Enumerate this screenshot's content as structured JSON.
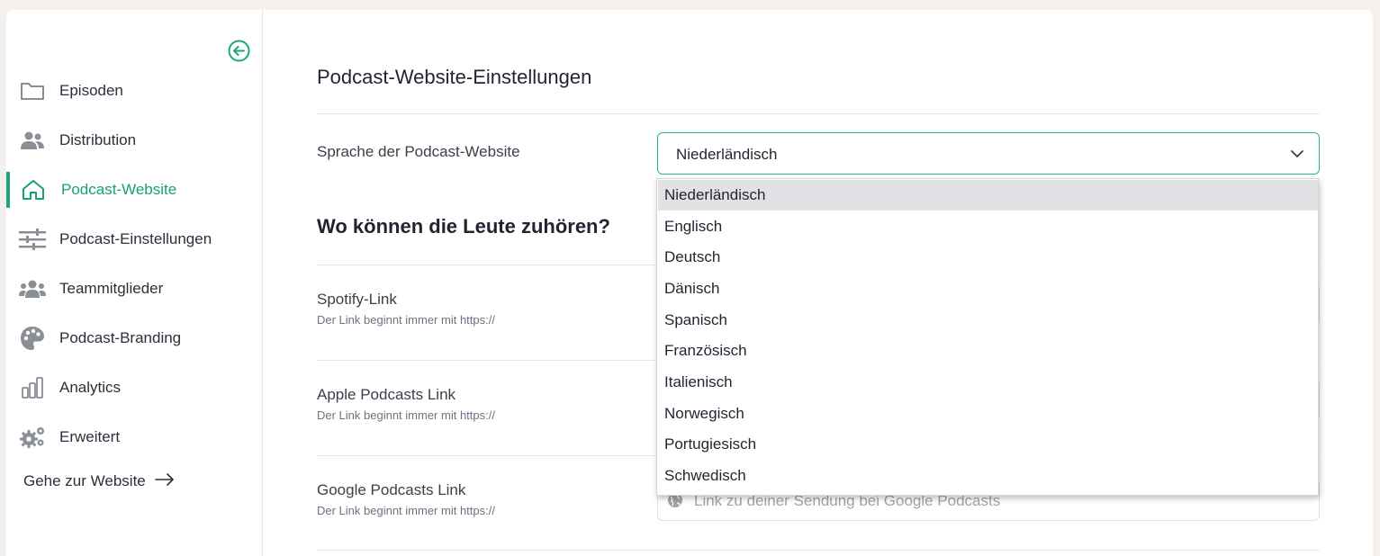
{
  "sidebar": {
    "items": [
      {
        "label": "Episoden",
        "icon": "folder-icon"
      },
      {
        "label": "Distribution",
        "icon": "users-icon"
      },
      {
        "label": "Podcast-Website",
        "icon": "home-icon"
      },
      {
        "label": "Podcast-Einstellungen",
        "icon": "sliders-icon"
      },
      {
        "label": "Teammitglieder",
        "icon": "team-icon"
      },
      {
        "label": "Podcast-Branding",
        "icon": "palette-icon"
      },
      {
        "label": "Analytics",
        "icon": "bar-chart-icon"
      },
      {
        "label": "Erweitert",
        "icon": "gears-icon"
      }
    ],
    "active_index": 2,
    "goto_label": "Gehe zur Website"
  },
  "main": {
    "title": "Podcast-Website-Einstellungen",
    "language_label": "Sprache der Podcast-Website",
    "language_value": "Niederländisch",
    "listen_title": "Wo können die Leute zuhören?",
    "links": [
      {
        "label": "Spotify-Link",
        "hint": "Der Link beginnt immer mit https://"
      },
      {
        "label": "Apple Podcasts Link",
        "hint": "Der Link beginnt immer mit https://"
      },
      {
        "label": "Google Podcasts Link",
        "hint": "Der Link beginnt immer mit https://",
        "placeholder": "Link zu deiner Sendung bei Google Podcasts"
      }
    ]
  },
  "dropdown": {
    "options": [
      "Niederländisch",
      "Englisch",
      "Deutsch",
      "Dänisch",
      "Spanisch",
      "Französisch",
      "Italienisch",
      "Norwegisch",
      "Portugiesisch",
      "Schwedisch"
    ],
    "selected_index": 0
  },
  "colors": {
    "accent": "#16a271",
    "background": "#f4f1ec",
    "selected_option": "#e2e1e6"
  }
}
